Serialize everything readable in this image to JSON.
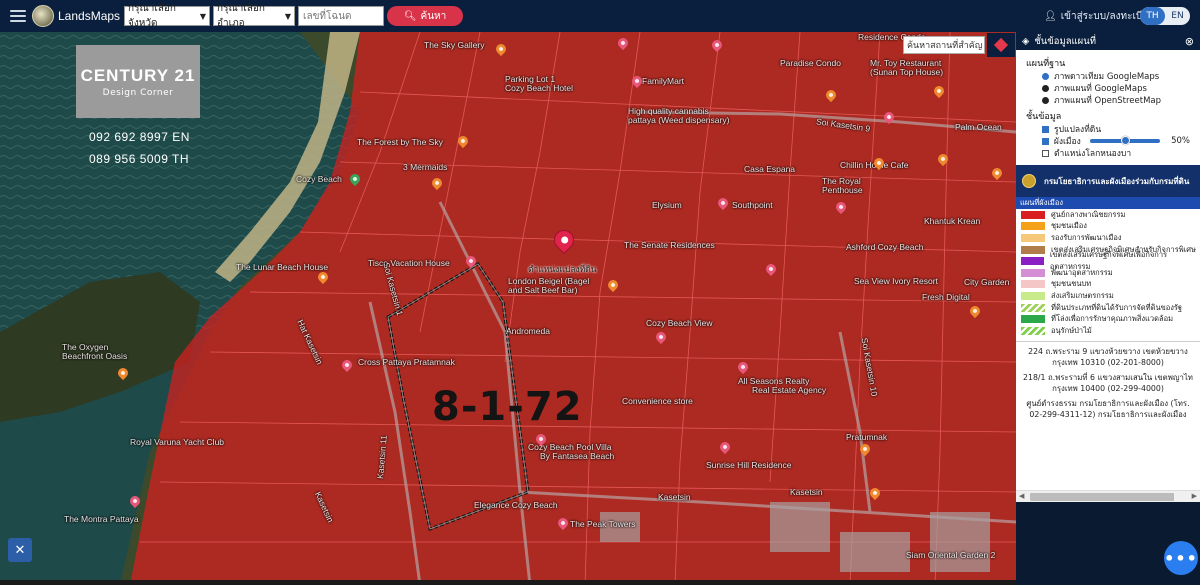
{
  "topbar": {
    "brand": "LandsMaps",
    "province_select": "กรุณาเลือกจังหวัด",
    "district_select": "กรุณาเลือกอำเภอ",
    "deed_placeholder": "เลขที่โฉนด",
    "search_label": "ค้นหา",
    "login_label": "เข้าสู่ระบบ/ลงทะเบียน",
    "lang_th": "TH",
    "lang_en": "EN"
  },
  "map": {
    "search_placeholder": "ค้นหาสถานที่สำคัญ",
    "plot_number": "8-1-72",
    "main_pin_label": "ตำแหน่งแปลงที่ดิน",
    "places": {
      "p1": "The Sky Gallery",
      "p2": "Parking Lot 1",
      "p3": "Cozy Beach Hotel",
      "p4": "FamilyMart",
      "p5": "High quality cannabis",
      "p6": "pattaya (Weed dispensary)",
      "p7": "Residence Condo",
      "p8": "Mr. Toy Restaurant",
      "p9": "(Sunan Top House)",
      "p10": "Paradise Condo",
      "p11": "Palm Ocean",
      "p12": "The Forest by The Sky",
      "p13": "3 Mermaids",
      "p14": "Cozy Beach",
      "p15": "Chillin Home Cafe",
      "p16": "Casa Espana",
      "p17": "The Royal",
      "p18": "Penthouse",
      "p19": "Elysium",
      "p20": "Southpoint",
      "p21": "Khantuk Krean",
      "p22": "The Senate Residences",
      "p23": "Ashford Cozy Beach",
      "p24": "Tisco Vacation House",
      "p25": "The Lunar Beach House",
      "p26": "London Beigel (Bagel",
      "p27": "and Salt Beef Bar)",
      "p28": "Sea View Ivory Resort",
      "p29": "Fresh Digital",
      "p30": "City Garden",
      "p31": "Andromeda",
      "p32": "Cozy Beach View",
      "p33": "The Oxygen",
      "p34": "Beachfront Oasis",
      "p35": "Cross Pattaya Pratamnak",
      "p36": "All Seasons Realty",
      "p37": "Real Estate Agency",
      "p38": "Convenience store",
      "p39": "Royal Varuna Yacht Club",
      "p40": "Cozy Beach Pool Villa",
      "p41": "By Fantasea Beach",
      "p42": "Pratumnak",
      "p43": "Sunrise Hill Residence",
      "p44": "Elegance Cozy Beach",
      "p45": "The Peak Towers",
      "p46": "The Montra Pattaya",
      "p47": "Kasetsin",
      "p48": "Siam Oriental Garden 2",
      "p49": "Kasetsin",
      "p50": "Soi Kasetsin 1",
      "p51": "Kasetsin 11",
      "p52": "Hat Kasetsin",
      "p53": "Kasetsin",
      "p54": "Soi Kasetsin 10",
      "p55": "Soi Kasetsin 9"
    }
  },
  "overlay": {
    "logo_line1": "CENTURY 21",
    "logo_line2": "Design Corner",
    "phone_en": "092 692 8997 EN",
    "phone_th": "089 956 5009 TH"
  },
  "panel": {
    "title": "ชั้นข้อมูลแผนที่",
    "basemap_title": "แผนที่ฐาน",
    "basemap_options": [
      "ภาพดาวเทียม GoogleMaps",
      "ภาพแผนที่ GoogleMaps",
      "ภาพแผนที่ OpenStreetMap"
    ],
    "layers_title": "ชั้นข้อมูล",
    "layer_parcel": "รูปแปลงที่ดิน",
    "layer_cityplan": "ผังเมือง",
    "opacity_percent": 50,
    "opacity_label": "50%",
    "layer_office": "ตำแหน่งโลกหนองบา",
    "dept_name": "กรมโยธาธิการและผังเมืองร่วมกับกรมที่ดิน",
    "legend_title": "แผนที่ผังเมือง",
    "legend": [
      {
        "label": "ศูนย์กลางพาณิชยกรรม",
        "color": "#d81e1e"
      },
      {
        "label": "ชุมชนเมือง",
        "color": "#f5a21a"
      },
      {
        "label": "รองรับการพัฒนาเมือง",
        "color": "#f6c87a"
      },
      {
        "label": "เขตส่งเสริมเศรษฐกิจพิเศษสำหรับกิจการพิเศษ",
        "color": "#b07c4a"
      },
      {
        "label": "เขตส่งเสริมเศรษฐกิจพิเศษเพื่อกิจการอุตสาหกรรม",
        "color": "#8a1fc4"
      },
      {
        "label": "พัฒนาอุตสาหกรรม",
        "color": "#d58ed6"
      },
      {
        "label": "ชุมชนชนบท",
        "color": "#f4c6c6"
      },
      {
        "label": "ส่งเสริมเกษตรกรรม",
        "color": "#c8ea8a"
      },
      {
        "label": "ที่ดินประเภทที่ดินได้รับการจัดที่ดินของรัฐ",
        "color": "#9fd05a"
      },
      {
        "label": "ที่โล่งเพื่อการรักษาคุณภาพสิ่งแวดล้อม",
        "color": "#2aa84a"
      },
      {
        "label": "อนุรักษ์ป่าไม้",
        "color": "#7fd04a"
      }
    ],
    "address1": "224 ถ.พระราม 9 แขวงห้วยขวาง เขตห้วยขวาง กรุงเทพ 10310 (02-201-8000)",
    "address2": "218/1 ถ.พระรามที่ 6 แขวงสามเสนใน เขตพญาไท กรุงเทพ 10400 (02-299-4000)",
    "address3": "ศูนย์ดำรงธรรม กรมโยธาธิการและผังเมือง (โทร. 02-299-4311-12) กรมโยธาธิการและผังเมือง"
  },
  "colors": {
    "topbar": "#0a1f3d",
    "zone_red": "#d81e1e",
    "accent_blue": "#2f6fc4",
    "search_btn": "#d9334a"
  }
}
